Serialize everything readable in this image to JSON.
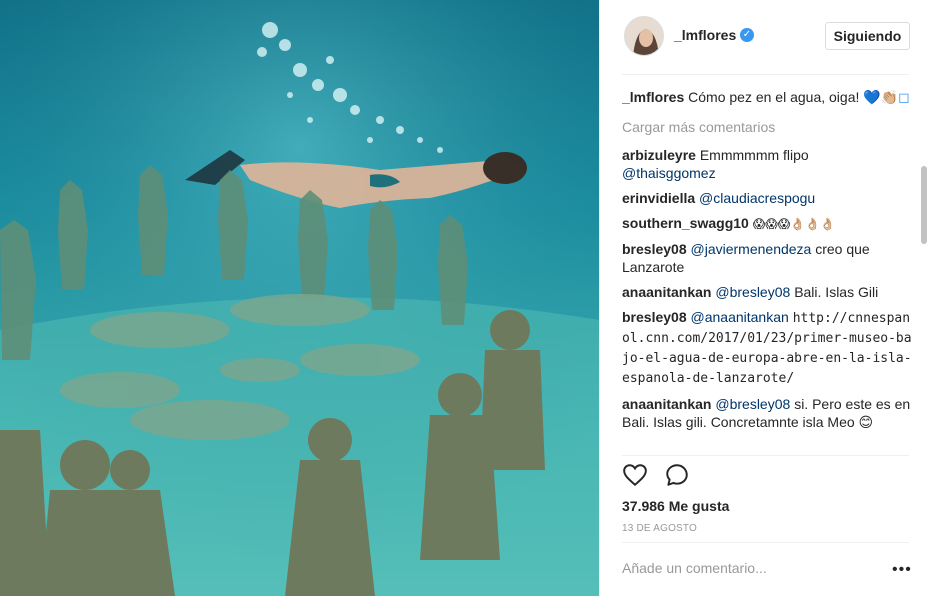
{
  "header": {
    "username": "_lmflores",
    "follow_label": "Siguiendo",
    "verified_icon": "verified-badge-icon"
  },
  "caption": {
    "user": "_lmflores",
    "text": "Cómo pez en el agua, oiga!",
    "emoji": "💙👏🏼◻"
  },
  "load_more": "Cargar más comentarios",
  "comments": [
    {
      "user": "arbizuleyre",
      "text": "Emmmmmm flipo",
      "mention": "@thaisggomez",
      "after": ""
    },
    {
      "user": "erinvidiella",
      "text": "",
      "mention": "@claudiacrespogu",
      "after": ""
    },
    {
      "user": "southern_swagg10",
      "text": "😱😱😱👌🏼👌🏼👌🏼",
      "mention": "",
      "after": ""
    },
    {
      "user": "bresley08",
      "text": "",
      "mention": "@javiermenendeza",
      "after": "creo que Lanzarote"
    },
    {
      "user": "anaanitankan",
      "text": "",
      "mention": "@bresley08",
      "after": "Bali. Islas Gili"
    },
    {
      "user": "bresley08",
      "text": "",
      "mention": "@anaanitankan",
      "after": "http://cnnespanol.cnn.com/2017/01/23/primer-museo-bajo-el-agua-de-europa-abre-en-la-isla-espanola-de-lanzarote/"
    },
    {
      "user": "anaanitankan",
      "text": "",
      "mention": "@bresley08",
      "after": "si. Pero este es en Bali. Islas gili. Concretamnte isla Meo 😊"
    }
  ],
  "actions": {
    "like_icon": "heart-icon",
    "comment_icon": "comment-bubble-icon"
  },
  "likes": "37.986 Me gusta",
  "date": "13 DE AGOSTO",
  "comment_placeholder": "Añade un comentario...",
  "more_options": "•••",
  "colors": {
    "link": "#003569",
    "muted": "#999999",
    "accent": "#3897f0",
    "water": "#1c8fa2"
  }
}
